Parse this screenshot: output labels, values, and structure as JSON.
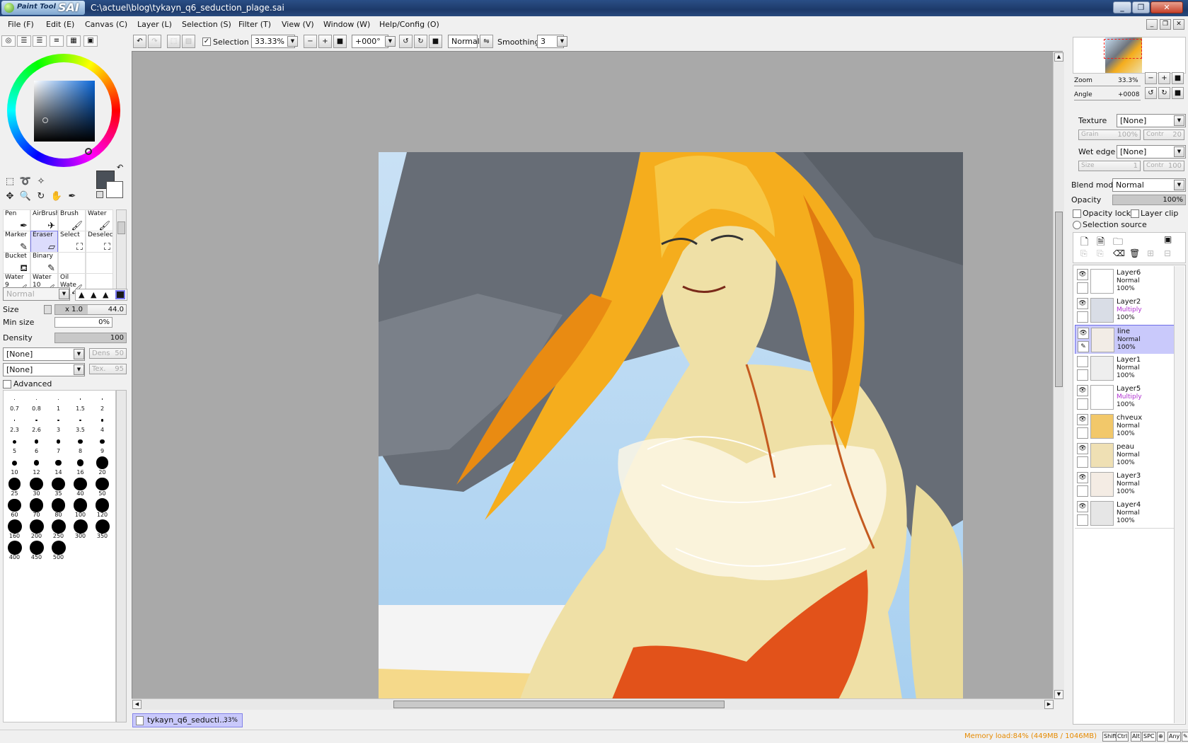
{
  "window": {
    "app_logo_small": "Paint Tool",
    "app_logo_big": "SAI",
    "title": "C:\\actuel\\blog\\tykayn_q6_seduction_plage.sai"
  },
  "menu": [
    "File (F)",
    "Edit (E)",
    "Canvas (C)",
    "Layer (L)",
    "Selection (S)",
    "Filter (T)",
    "View (V)",
    "Window (W)",
    "Help/Config (O)"
  ],
  "toolbar": {
    "selection_label": "Selection",
    "selection_checked": true,
    "zoom": "33.33%",
    "angle": "+000°",
    "blend": "Normal",
    "smoothing_label": "Smoothing",
    "smoothing_value": "3"
  },
  "brushes": [
    {
      "name": "Pen",
      "sub": "",
      "icon": "✒"
    },
    {
      "name": "AirBrush",
      "sub": "",
      "icon": "✈"
    },
    {
      "name": "Brush",
      "sub": "",
      "icon": "🖌"
    },
    {
      "name": "Water",
      "sub": "",
      "icon": "🖌"
    },
    {
      "name": "Marker",
      "sub": "",
      "icon": "✎"
    },
    {
      "name": "Eraser",
      "sub": "",
      "icon": "▱"
    },
    {
      "name": "Select",
      "sub": "",
      "icon": "⛶"
    },
    {
      "name": "Deselect",
      "sub": "",
      "icon": "⛶"
    },
    {
      "name": "Bucket",
      "sub": "",
      "icon": "⛾"
    },
    {
      "name": "Binary",
      "sub": "",
      "icon": "✎"
    },
    {
      "name": "",
      "sub": "",
      "icon": ""
    },
    {
      "name": "",
      "sub": "",
      "icon": ""
    },
    {
      "name": "Water",
      "sub": "9",
      "icon": "🖌"
    },
    {
      "name": "Water",
      "sub": "10",
      "icon": "🖌"
    },
    {
      "name": "Oil Wate",
      "sub": "",
      "icon": "🖌"
    },
    {
      "name": "",
      "sub": "",
      "icon": ""
    }
  ],
  "brush_settings": {
    "mode": "Normal",
    "size_label": "Size",
    "size_mult": "x 1.0",
    "size_value": "44.0",
    "min_size_label": "Min size",
    "min_size_value": "0%",
    "density_label": "Density",
    "density_value": "100",
    "shape_option": "[None]",
    "shape_param": "Dens",
    "shape_param_value": "50",
    "texture_option": "[None]",
    "texture_param": "Tex.",
    "texture_param_value": "95",
    "advanced_label": "Advanced"
  },
  "brush_sizes": [
    "0.7",
    "0.8",
    "1",
    "1.5",
    "2",
    "2.3",
    "2.6",
    "3",
    "3.5",
    "4",
    "5",
    "6",
    "7",
    "8",
    "9",
    "10",
    "12",
    "14",
    "16",
    "20",
    "25",
    "30",
    "35",
    "40",
    "50",
    "60",
    "70",
    "80",
    "100",
    "120",
    "160",
    "200",
    "250",
    "300",
    "350",
    "400",
    "450",
    "500"
  ],
  "document_tab": {
    "name": "tykayn_q6_seducti...",
    "zoom": "33%"
  },
  "navigator": {
    "zoom_label": "Zoom",
    "zoom_value": "33.3%",
    "angle_label": "Angle",
    "angle_value": "+0008"
  },
  "layer_props": {
    "texture_label": "Texture",
    "texture_value": "[None]",
    "grain_label": "Grain",
    "grain_value": "100%",
    "contr_label": "Contr",
    "contr_value": "20",
    "wet_edge_label": "Wet edge",
    "wet_edge_value": "[None]",
    "size_label": "Size",
    "size_value": "1",
    "contr2_label": "Contr",
    "contr2_value": "100",
    "blend_label": "Blend mode",
    "blend_value": "Normal",
    "opacity_label": "Opacity",
    "opacity_value": "100%",
    "opacity_lock_label": "Opacity lock",
    "layer_clip_label": "Layer clip",
    "selection_source_label": "Selection source"
  },
  "layers": [
    {
      "name": "Layer6",
      "mode": "Normal",
      "opacity": "100%",
      "visible": true,
      "selected": false,
      "thumb": "#ffffff"
    },
    {
      "name": "Layer2",
      "mode": "Multiply",
      "opacity": "100%",
      "visible": true,
      "selected": false,
      "thumb": "#d9dde6"
    },
    {
      "name": "line",
      "mode": "Normal",
      "opacity": "100%",
      "visible": true,
      "selected": true,
      "thumb": "#f2ece6"
    },
    {
      "name": "Layer1",
      "mode": "Normal",
      "opacity": "100%",
      "visible": false,
      "selected": false,
      "thumb": "#eeeeee"
    },
    {
      "name": "Layer5",
      "mode": "Multiply",
      "opacity": "100%",
      "visible": true,
      "selected": false,
      "thumb": "#ffffff"
    },
    {
      "name": "chveux",
      "mode": "Normal",
      "opacity": "100%",
      "visible": true,
      "selected": false,
      "thumb": "#f2c86a"
    },
    {
      "name": "peau",
      "mode": "Normal",
      "opacity": "100%",
      "visible": true,
      "selected": false,
      "thumb": "#efe0b4"
    },
    {
      "name": "Layer3",
      "mode": "Normal",
      "opacity": "100%",
      "visible": true,
      "selected": false,
      "thumb": "#f4ece4"
    },
    {
      "name": "Layer4",
      "mode": "Normal",
      "opacity": "100%",
      "visible": true,
      "selected": false,
      "thumb": "#e6e6e6"
    }
  ],
  "status": {
    "memory": "Memory load:84% (449MB / 1046MB)",
    "keys": [
      "Shift",
      "Ctrl",
      "Alt",
      "SPC",
      "⊕",
      "Any",
      "✎"
    ]
  },
  "colors": {
    "accent": "#c9c9fb",
    "accent_border": "#6e6ee6",
    "memory_text": "#e68a00",
    "primary_color": "#4a5058"
  }
}
